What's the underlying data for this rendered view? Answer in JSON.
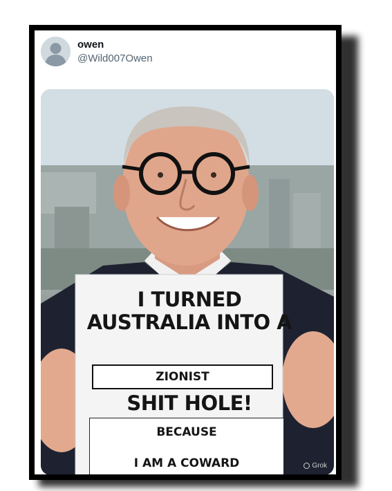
{
  "post": {
    "author": {
      "name": "owen",
      "handle": "@Wild007Owen"
    },
    "image": {
      "sign": {
        "headline": "I TURNED AUSTRALIA INTO A",
        "highlight": "ZIONIST",
        "continuation": "SHIT HOLE!",
        "reason_label": "BECAUSE",
        "reason": "I AM A COWARD"
      },
      "watermark": "Grok"
    }
  }
}
